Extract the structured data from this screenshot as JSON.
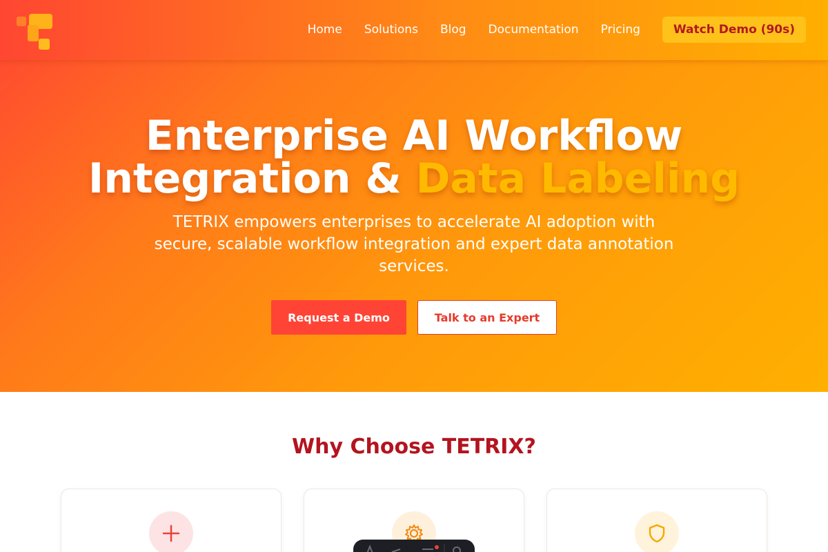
{
  "nav": {
    "links": [
      "Home",
      "Solutions",
      "Blog",
      "Documentation",
      "Pricing"
    ],
    "cta": "Watch Demo (90s)"
  },
  "hero": {
    "title_line1": "Enterprise AI Workflow",
    "title_line2_main": "Integration & ",
    "title_line2_accent": "Data Labeling",
    "subtitle": "TETRIX empowers enterprises to accelerate AI adoption with secure, scalable workflow integration and expert data annotation services.",
    "primary_button": "Request a Demo",
    "secondary_button": "Talk to an Expert"
  },
  "why": {
    "title": "Why Choose TETRIX?",
    "cards": [
      {
        "icon": "plus-icon"
      },
      {
        "icon": "gear-icon"
      },
      {
        "icon": "shield-icon"
      }
    ]
  },
  "colors": {
    "brand_red": "#ff4436",
    "brand_orange": "#ff9a0a",
    "brand_yellow": "#ffb000",
    "heading_red": "#b3141f"
  }
}
